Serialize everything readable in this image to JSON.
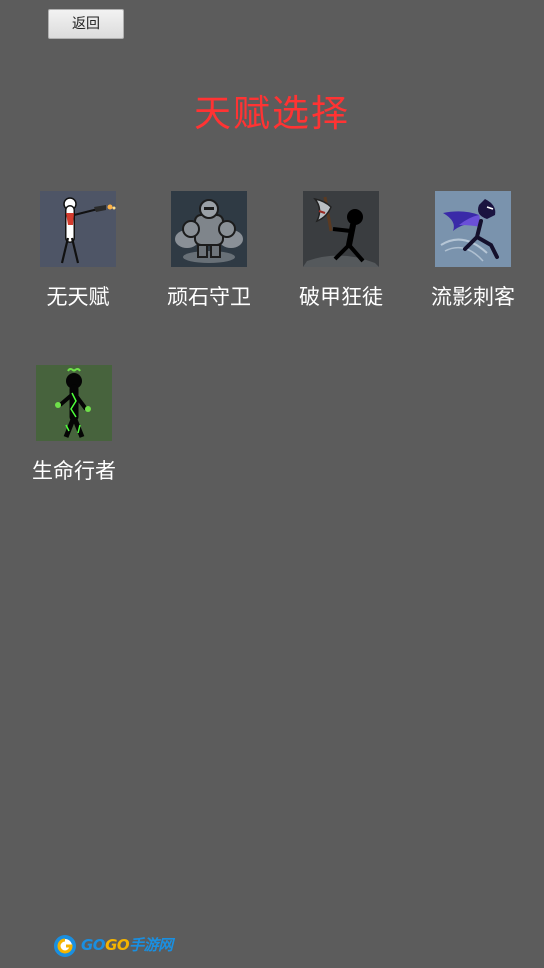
{
  "header": {
    "back_label": "返回",
    "title": "天赋选择",
    "title_color": "#ff3333"
  },
  "talents": [
    {
      "name": "无天赋",
      "icon": "stickman-gunner-icon"
    },
    {
      "name": "顽石守卫",
      "icon": "stone-golem-icon"
    },
    {
      "name": "破甲狂徒",
      "icon": "axe-berserker-icon"
    },
    {
      "name": "流影刺客",
      "icon": "shadow-assassin-icon"
    },
    {
      "name": "生命行者",
      "icon": "life-walker-icon"
    }
  ],
  "watermark": {
    "go1": "GO",
    "go2": "GO",
    "suffix": "手游网"
  },
  "colors": {
    "background": "#5c5c5c",
    "label": "#ffffff"
  }
}
